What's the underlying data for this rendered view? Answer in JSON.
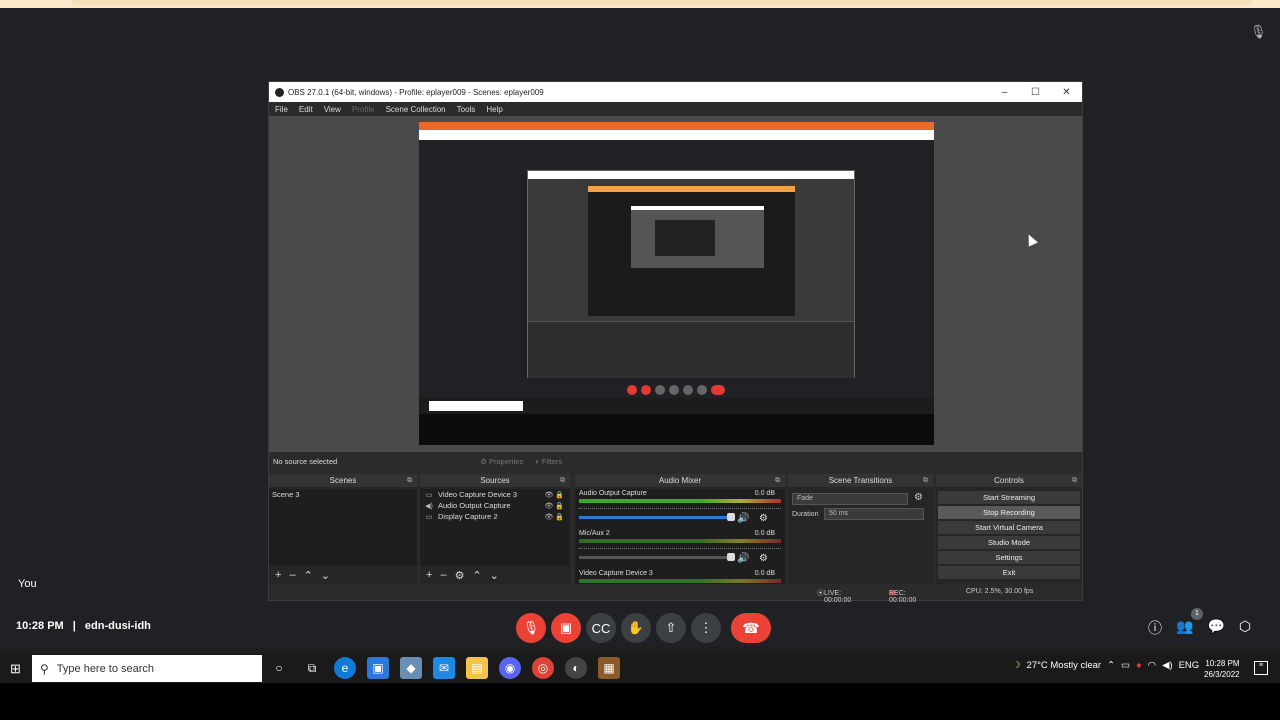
{
  "obs": {
    "title": "OBS 27.0.1 (64-bit, windows) - Profile: eplayer009 - Scenes: eplayer009",
    "menu": [
      "File",
      "Edit",
      "View",
      "Profile",
      "Scene Collection",
      "Tools",
      "Help"
    ],
    "no_source": "No source selected",
    "properties_label": "Properties",
    "filters_label": "Filters",
    "scenes": {
      "header": "Scenes",
      "items": [
        "Scene 3"
      ]
    },
    "sources": {
      "header": "Sources",
      "items": [
        {
          "label": "Video Capture Device 3",
          "icon": "camera-icon"
        },
        {
          "label": "Audio Output Capture",
          "icon": "speaker-icon"
        },
        {
          "label": "Display Capture 2",
          "icon": "monitor-icon"
        }
      ]
    },
    "mixer": {
      "header": "Audio Mixer",
      "channels": [
        {
          "name": "Audio Output Capture",
          "db": "0.0 dB",
          "level": 0.6,
          "muted": false
        },
        {
          "name": "Mic/Aux 2",
          "db": "0.0 dB",
          "level": 0.0,
          "muted": true
        },
        {
          "name": "Video Capture Device 3",
          "db": "0.0 dB",
          "level": 0.0,
          "muted": false
        }
      ]
    },
    "transitions": {
      "header": "Scene Transitions",
      "type": "Fade",
      "duration_label": "Duration",
      "duration": "50 ms"
    },
    "controls": {
      "header": "Controls",
      "buttons": [
        "Start Streaming",
        "Stop Recording",
        "Start Virtual Camera",
        "Studio Mode",
        "Settings",
        "Exit"
      ]
    },
    "status": {
      "live": "LIVE: 00:00:00",
      "rec": "REC: 00:00:00",
      "cpu": "CPU: 2.5%, 30.00 fps"
    }
  },
  "meet": {
    "you_label": "You",
    "time": "10:28 PM",
    "separator": "|",
    "meeting_code": "edn-dusi-idh",
    "participants_badge": "1"
  },
  "taskbar": {
    "search_placeholder": "Type here to search",
    "weather": "27°C  Mostly clear",
    "lang": "ENG",
    "clock_time": "10:28 PM",
    "clock_date": "26/3/2022"
  },
  "colors": {
    "meet_red": "#ea4335",
    "obs_bg": "#2b2b2b",
    "accent_orange": "#e86b2c"
  }
}
